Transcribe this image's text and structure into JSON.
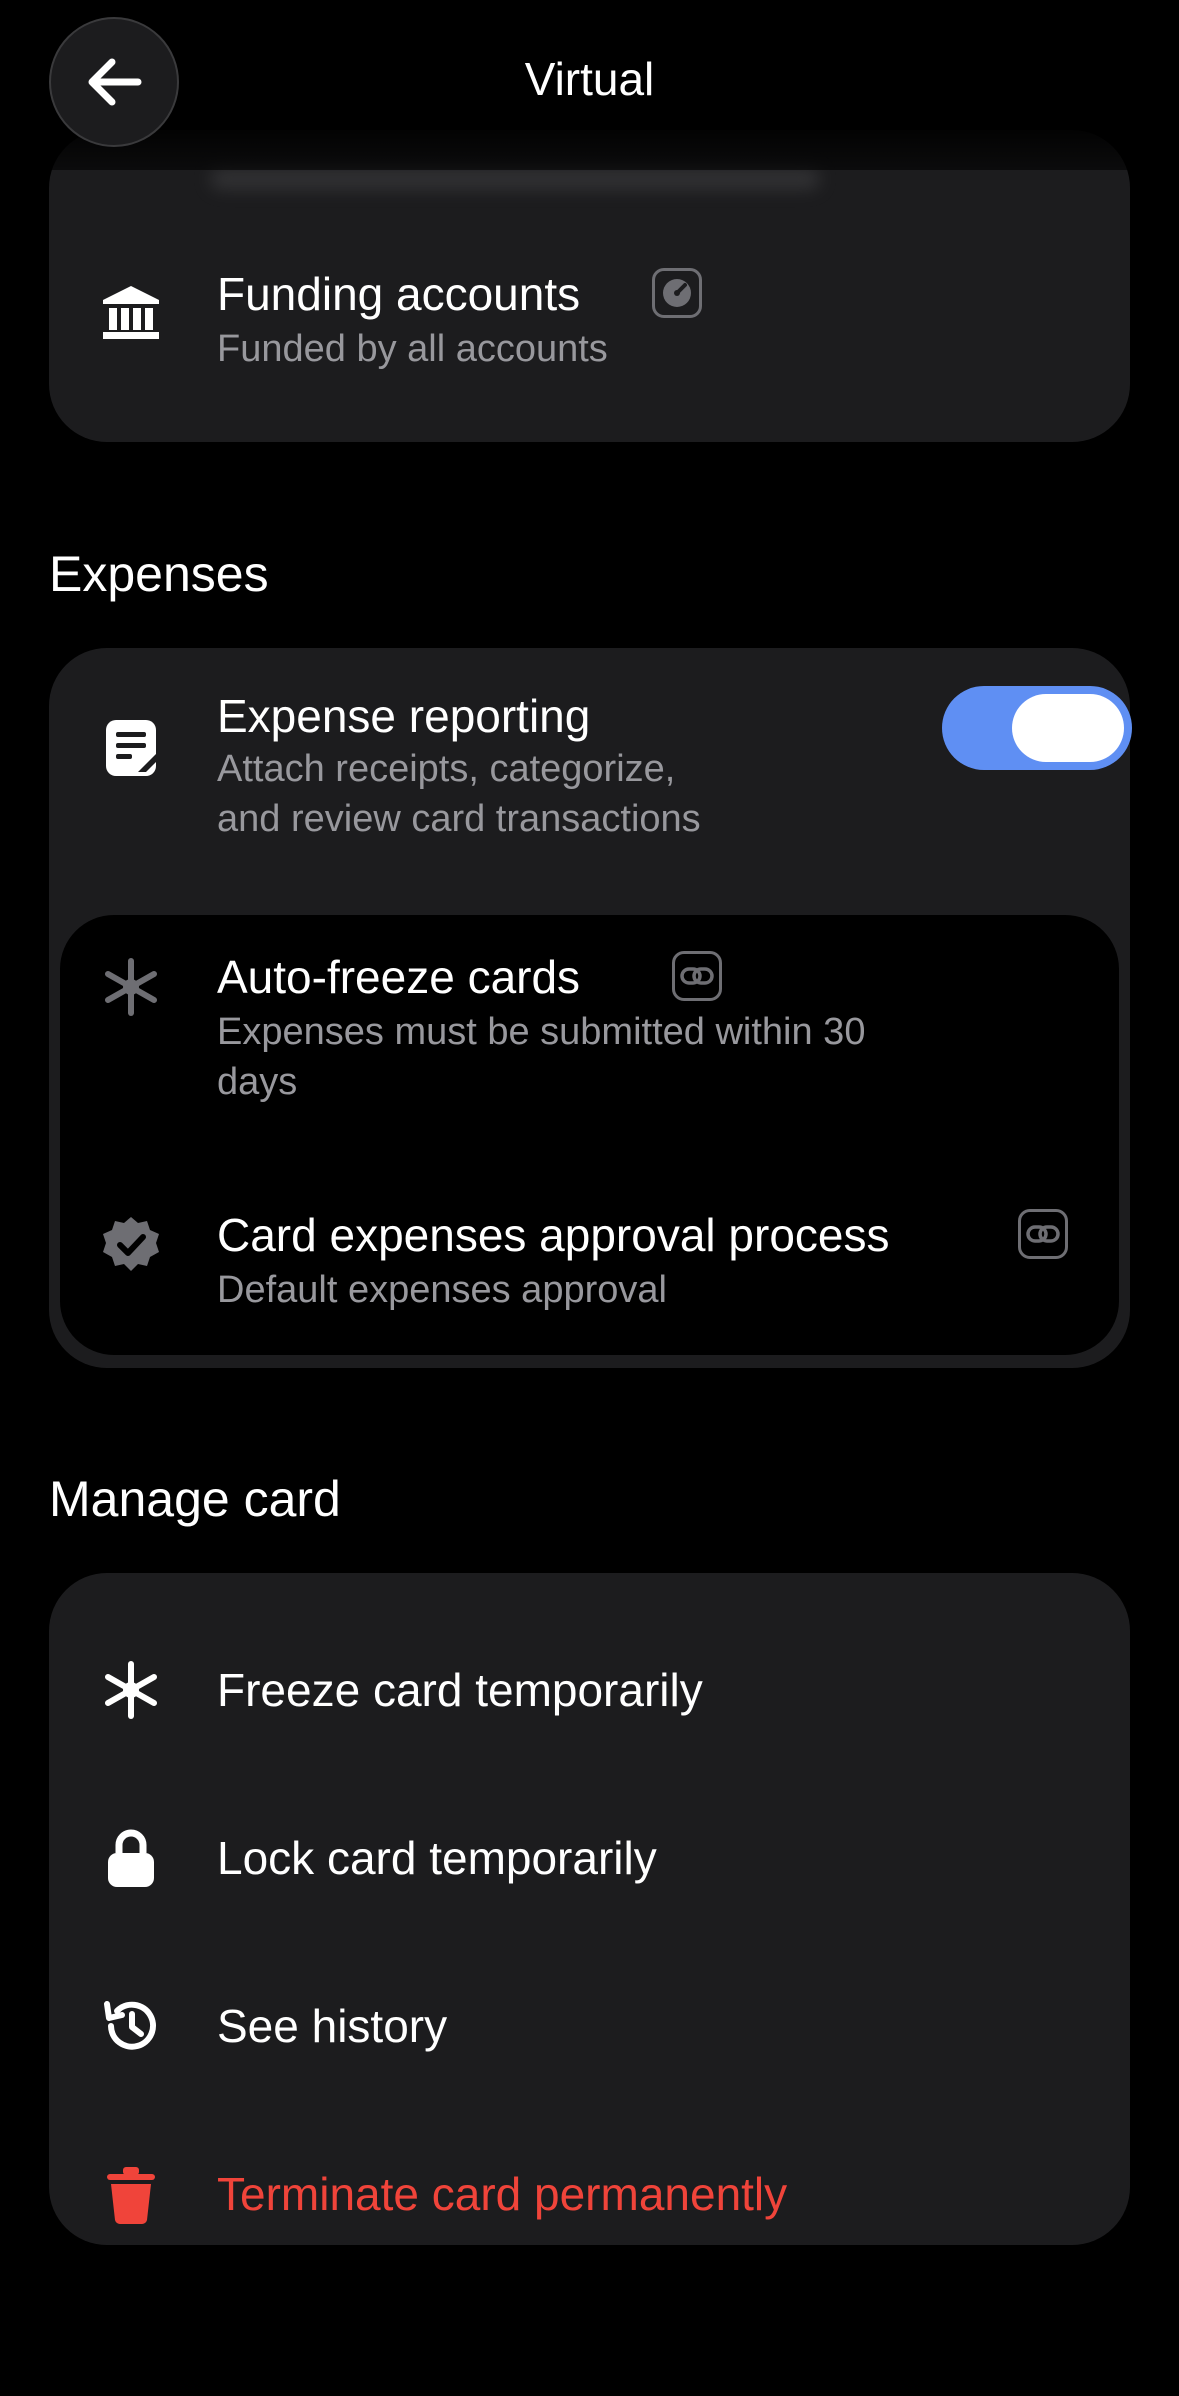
{
  "header": {
    "title": "Virtual",
    "back_label": "Back"
  },
  "funding": {
    "title": "Funding accounts",
    "subtitle": "Funded by all accounts"
  },
  "expenses": {
    "section_title": "Expenses",
    "reporting": {
      "title": "Expense reporting",
      "subtitle_line1": "Attach receipts, categorize,",
      "subtitle_line2": "and review card transactions",
      "enabled": true
    },
    "auto_freeze": {
      "title": "Auto-freeze cards",
      "subtitle_line1": "Expenses must be submitted within 30",
      "subtitle_line2": "days"
    },
    "approval": {
      "title": "Card expenses approval process",
      "subtitle": "Default expenses approval"
    }
  },
  "manage": {
    "section_title": "Manage card",
    "items": [
      {
        "label": "Freeze card temporarily",
        "icon": "snowflake-icon"
      },
      {
        "label": "Lock card temporarily",
        "icon": "lock-icon"
      },
      {
        "label": "See history",
        "icon": "history-icon"
      },
      {
        "label": "Terminate card permanently",
        "icon": "trash-icon"
      }
    ]
  },
  "colors": {
    "background": "#000000",
    "card": "#1c1c1e",
    "toggle_on": "#5f8ff3",
    "danger": "#f0443a",
    "secondary_text": "#98989d"
  }
}
